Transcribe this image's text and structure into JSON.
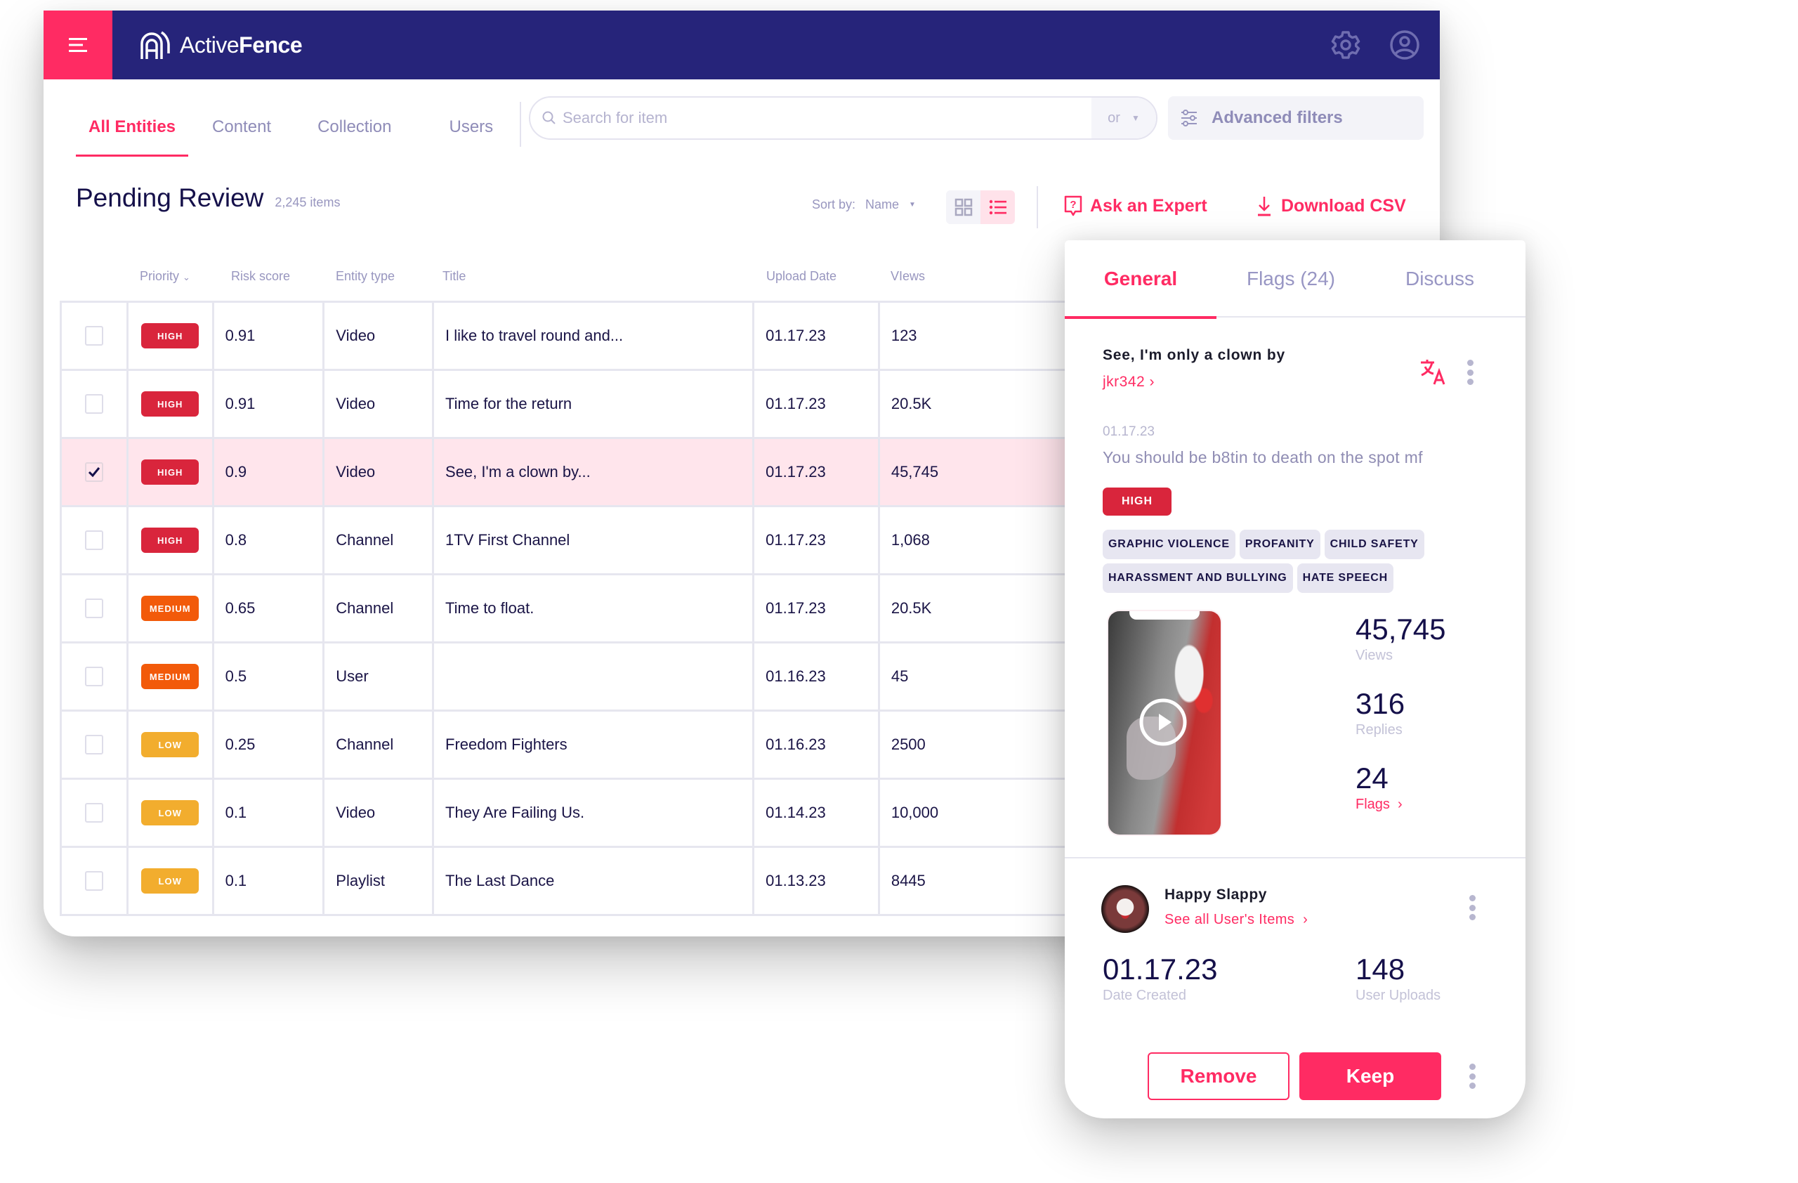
{
  "app": {
    "brand_light": "Active",
    "brand_bold": "Fence",
    "colors": {
      "accent": "#ff2b63",
      "navy": "#26247a",
      "high": "#d9253c",
      "medium": "#f25a0a",
      "low": "#f2ad2e",
      "selected_row": "#ffe5ec"
    }
  },
  "icons": {
    "menu": "hamburger-icon",
    "settings": "gear-icon",
    "profile": "user-circle-icon",
    "search": "search-icon",
    "filters": "sliders-icon",
    "grid_view": "grid-icon",
    "list_view": "list-icon",
    "ask_expert": "question-bubble-icon",
    "download": "download-icon",
    "translate": "translate-icon",
    "more": "kebab-icon",
    "play": "play-icon"
  },
  "nav": {
    "tabs": [
      {
        "label": "All Entities",
        "active": true
      },
      {
        "label": "Content",
        "active": false
      },
      {
        "label": "Collection",
        "active": false
      },
      {
        "label": "Users",
        "active": false
      }
    ],
    "search_placeholder": "Search for item",
    "search_value": "",
    "operator": "or",
    "advanced_filters": "Advanced filters"
  },
  "page": {
    "title": "Pending Review",
    "count": "2,245 items",
    "sort_label": "Sort by:",
    "sort_value": "Name",
    "view_mode": "list",
    "ask_expert": "Ask an Expert",
    "download_csv": "Download CSV"
  },
  "table": {
    "columns": [
      "Priority",
      "Risk score",
      "Entity type",
      "Title",
      "Upload Date",
      "VIews"
    ],
    "rows": [
      {
        "checked": false,
        "priority": "HIGH",
        "level": "high",
        "risk": "0.91",
        "type": "Video",
        "title": "I like to travel round and...",
        "date": "01.17.23",
        "views": "123"
      },
      {
        "checked": false,
        "priority": "HIGH",
        "level": "high",
        "risk": "0.91",
        "type": "Video",
        "title": "Time for the return",
        "date": "01.17.23",
        "views": "20.5K"
      },
      {
        "checked": true,
        "priority": "HIGH",
        "level": "high",
        "risk": "0.9",
        "type": "Video",
        "title": "See, I'm a clown by...",
        "date": "01.17.23",
        "views": "45,745"
      },
      {
        "checked": false,
        "priority": "HIGH",
        "level": "high",
        "risk": "0.8",
        "type": "Channel",
        "title": "1TV First Channel",
        "date": "01.17.23",
        "views": "1,068"
      },
      {
        "checked": false,
        "priority": "MEDIUM",
        "level": "medium",
        "risk": "0.65",
        "type": "Channel",
        "title": "Time to float.",
        "date": "01.17.23",
        "views": "20.5K"
      },
      {
        "checked": false,
        "priority": "MEDIUM",
        "level": "medium",
        "risk": "0.5",
        "type": "User",
        "title": "",
        "date": "01.16.23",
        "views": "45"
      },
      {
        "checked": false,
        "priority": "LOW",
        "level": "low",
        "risk": "0.25",
        "type": "Channel",
        "title": "Freedom Fighters",
        "date": "01.16.23",
        "views": "2500"
      },
      {
        "checked": false,
        "priority": "LOW",
        "level": "low",
        "risk": "0.1",
        "type": "Video",
        "title": "They Are Failing Us.",
        "date": "01.14.23",
        "views": "10,000"
      },
      {
        "checked": false,
        "priority": "LOW",
        "level": "low",
        "risk": "0.1",
        "type": "Playlist",
        "title": "The Last Dance",
        "date": "01.13.23",
        "views": "8445"
      }
    ]
  },
  "panel": {
    "tabs": [
      {
        "label": "General",
        "active": true
      },
      {
        "label": "Flags (24)",
        "active": false
      },
      {
        "label": "Discuss",
        "active": false
      }
    ],
    "item_title": "See, I'm only a clown by",
    "author": "jkr342",
    "date": "01.17.23",
    "text": "You should be b8tin to death on the spot mf",
    "priority": "HIGH",
    "tags": [
      "GRAPHIC VIOLENCE",
      "PROFANITY",
      "CHILD SAFETY",
      "HARASSMENT AND BULLYING",
      "HATE SPEECH"
    ],
    "stats": [
      {
        "value": "45,745",
        "label": "Views",
        "link": false
      },
      {
        "value": "316",
        "label": "Replies",
        "link": false
      },
      {
        "value": "24",
        "label": "Flags",
        "link": true
      }
    ],
    "user": {
      "name": "Happy Slappy",
      "link": "See all User's Items",
      "date_created": "01.17.23",
      "date_created_label": "Date Created",
      "uploads": "148",
      "uploads_label": "User Uploads"
    },
    "actions": {
      "remove": "Remove",
      "keep": "Keep"
    }
  }
}
